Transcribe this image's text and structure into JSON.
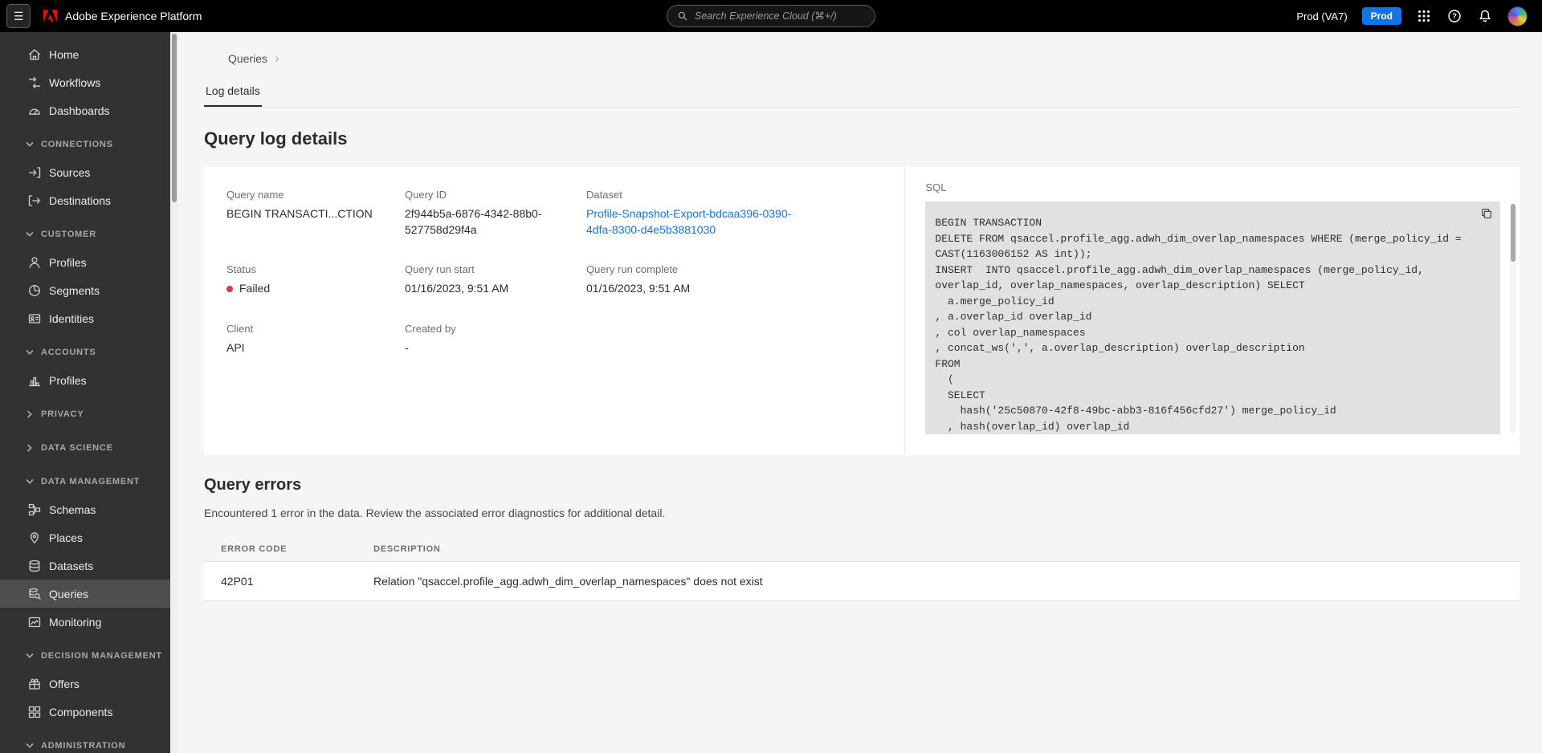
{
  "colors": {
    "accent_blue": "#1473e6",
    "status_failed_red": "#d7373f",
    "topbar_bg": "#000000",
    "sidebar_bg": "#323232",
    "code_bg": "#e1e1e1"
  },
  "icons": {
    "hamburger": "☰",
    "help": "?",
    "breadcrumb_chevron": "›"
  },
  "topbar": {
    "app_title": "Adobe Experience Platform",
    "search_placeholder": "Search Experience Cloud (⌘+/)",
    "environment": "Prod (VA7)",
    "environment_badge": "Prod"
  },
  "sidebar": {
    "items": [
      "Home",
      "Workflows",
      "Dashboards"
    ],
    "sections": [
      {
        "label": "CONNECTIONS",
        "expanded": true,
        "items": [
          "Sources",
          "Destinations"
        ]
      },
      {
        "label": "CUSTOMER",
        "expanded": true,
        "items": [
          "Profiles",
          "Segments",
          "Identities"
        ]
      },
      {
        "label": "ACCOUNTS",
        "expanded": true,
        "items": [
          "Profiles"
        ]
      },
      {
        "label": "PRIVACY",
        "expanded": false,
        "items": []
      },
      {
        "label": "DATA SCIENCE",
        "expanded": false,
        "items": []
      },
      {
        "label": "DATA MANAGEMENT",
        "expanded": true,
        "items": [
          "Schemas",
          "Places",
          "Datasets",
          "Queries",
          "Monitoring"
        ]
      },
      {
        "label": "DECISION MANAGEMENT",
        "expanded": true,
        "items": [
          "Offers",
          "Components"
        ]
      },
      {
        "label": "ADMINISTRATION",
        "expanded": true,
        "items": []
      }
    ],
    "active_item": "Queries"
  },
  "main": {
    "breadcrumb": "Queries",
    "tab": "Log details",
    "title": "Query log details",
    "details": {
      "fields": [
        {
          "label": "Query name",
          "value": "BEGIN TRANSACTI...CTION"
        },
        {
          "label": "Query ID",
          "value": "2f944b5a-6876-4342-88b0-527758d29f4a"
        },
        {
          "label": "Dataset",
          "value": "Profile-Snapshot-Export-bdcaa396-0390-4dfa-8300-d4e5b3881030"
        },
        {
          "label": "Status",
          "value": "Failed"
        },
        {
          "label": "Query run start",
          "value": "01/16/2023, 9:51 AM"
        },
        {
          "label": "Query run complete",
          "value": "01/16/2023, 9:51 AM"
        },
        {
          "label": "Client",
          "value": "API"
        },
        {
          "label": "Created by",
          "value": "-"
        }
      ]
    },
    "sql": {
      "label": "SQL",
      "code": "BEGIN TRANSACTION\nDELETE FROM qsaccel.profile_agg.adwh_dim_overlap_namespaces WHERE (merge_policy_id =\nCAST(1163006152 AS int));\nINSERT  INTO qsaccel.profile_agg.adwh_dim_overlap_namespaces (merge_policy_id,\noverlap_id, overlap_namespaces, overlap_description) SELECT\n  a.merge_policy_id\n, a.overlap_id overlap_id\n, col overlap_namespaces\n, concat_ws(',', a.overlap_description) overlap_description\nFROM\n  (\n  SELECT\n    hash('25c50870-42f8-49bc-abb3-816f456cfd27') merge_policy_id\n  , hash(overlap_id) overlap_id"
    },
    "errors": {
      "title": "Query errors",
      "summary": "Encountered 1 error in the data. Review the associated error diagnostics for additional detail.",
      "headers": [
        "ERROR CODE",
        "DESCRIPTION"
      ],
      "rows": [
        {
          "code": "42P01",
          "description": "Relation \"qsaccel.profile_agg.adwh_dim_overlap_namespaces\" does not exist"
        }
      ]
    }
  }
}
